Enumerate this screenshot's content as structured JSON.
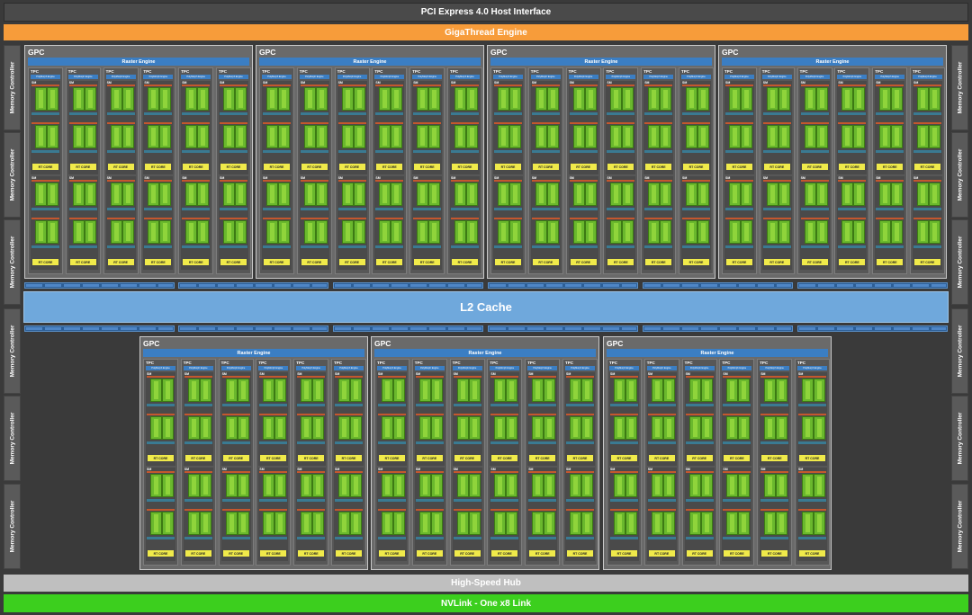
{
  "pcie": "PCI Express 4.0 Host Interface",
  "gigathread": "GigaThread Engine",
  "l2": "L2 Cache",
  "hub": "High-Speed Hub",
  "nvlink": "NVLink - One x8 Link",
  "memory_controller": "Memory Controller",
  "gpc": {
    "label": "GPC",
    "raster": "Raster Engine",
    "tpc_label": "TPC",
    "polymorph": "PolyMorph Engine",
    "sm_label": "SM",
    "rt_core": "RT CORE"
  },
  "colors": {
    "background": "#3a3a3a",
    "gigathread": "#f79c3a",
    "l2": "#6fa8dc",
    "raster": "#3b7ec3",
    "core": "#6ab82d",
    "rt_core": "#f0ea4a",
    "nvlink": "#3ccf1e",
    "hub": "#bfbfbf"
  }
}
